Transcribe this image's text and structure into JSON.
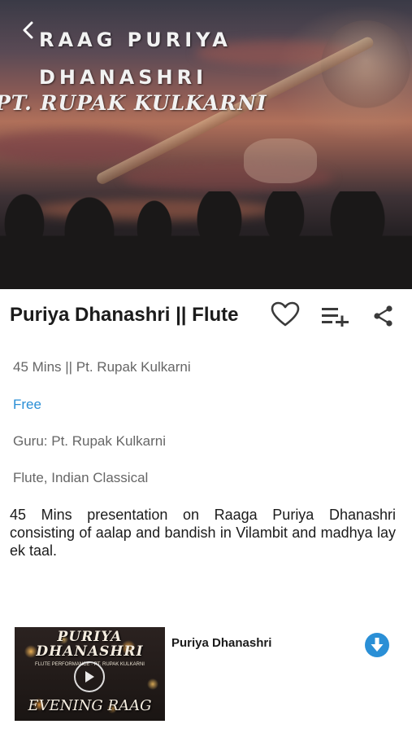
{
  "hero": {
    "title": "RAAG PURIYA DHANASHRI",
    "artist": "PT. RUPAK KULKARNI",
    "back_icon": "chevron-left-icon"
  },
  "content": {
    "title": "Puriya Dhanashri || Flute",
    "duration_artist": "45 Mins || Pt. Rupak Kulkarni",
    "price": "Free",
    "guru": "Guru: Pt. Rupak Kulkarni",
    "genre": "Flute, Indian Classical",
    "description": "45 Mins presentation on Raaga Puriya Dhanashri consisting of aalap and bandish in Vilambit and madhya lay ek taal."
  },
  "actions": {
    "favorite_icon": "heart-outline-icon",
    "queue_icon": "playlist-add-icon",
    "share_icon": "share-icon"
  },
  "track": {
    "thumb_line1": "PURIYA",
    "thumb_line2": "DHANASHRI",
    "thumb_sub": "FLUTE PERFORMANCE · PT. RUPAK KULKARNI",
    "thumb_bottom": "EVENING RAAG",
    "name": "Puriya Dhanashri",
    "download_icon": "download-circle-icon"
  },
  "colors": {
    "accent": "#2a8fd6",
    "text_primary": "#1b1b1b",
    "text_secondary": "#666666"
  }
}
